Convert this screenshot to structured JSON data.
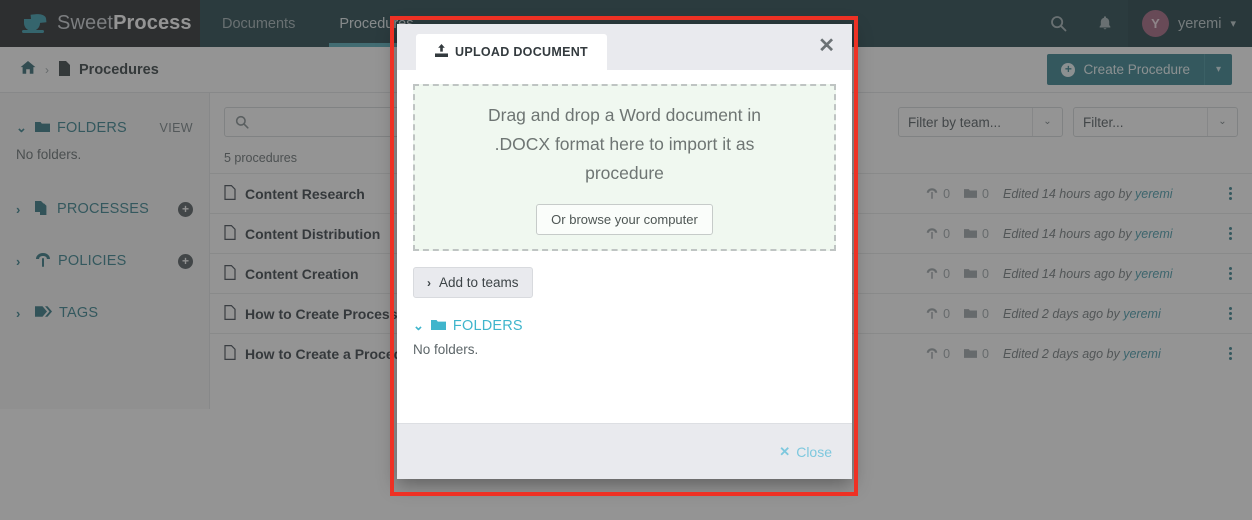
{
  "topnav": {
    "brand_light": "Sweet",
    "brand_bold": "Process",
    "items": [
      {
        "label": "Documents",
        "active": false
      },
      {
        "label": "Procedures",
        "active": true
      }
    ],
    "search_icon": "search-icon",
    "bell_icon": "bell-icon",
    "user": {
      "initial": "Y",
      "name": "yeremi",
      "caret": "⌄"
    }
  },
  "breadcrumb": {
    "home_icon": "home-icon",
    "separator": "›",
    "doc_icon": "document-icon",
    "label": "Procedures"
  },
  "create_button": {
    "plus": "+",
    "label": "Create Procedure",
    "split_caret": "▾"
  },
  "sidebar": {
    "folders": {
      "caret": "⌄",
      "icon": "folder-icon",
      "label": "FOLDERS",
      "view_label": "VIEW",
      "empty": "No folders."
    },
    "items": [
      {
        "caret": "›",
        "icon": "processes-icon",
        "label": "PROCESSES",
        "plus": "+"
      },
      {
        "caret": "›",
        "icon": "policies-icon",
        "label": "POLICIES",
        "plus": "+"
      },
      {
        "caret": "›",
        "icon": "tags-icon",
        "label": "TAGS",
        "plus": ""
      }
    ]
  },
  "toolbar": {
    "search_placeholder": "",
    "search_icon": "search-icon",
    "filter_team": "Filter by team...",
    "filter": "Filter...",
    "caret": "⌄"
  },
  "list": {
    "count_label": "5 procedures",
    "rows": [
      {
        "icon": "document-icon",
        "title": "Content Research",
        "signoff": "0",
        "folders": "0",
        "edited_prefix": "Edited 14 hours ago by ",
        "author": "yeremi",
        "menu": "kebab-menu-icon"
      },
      {
        "icon": "document-icon",
        "title": "Content Distribution",
        "signoff": "0",
        "folders": "0",
        "edited_prefix": "Edited 14 hours ago by ",
        "author": "yeremi",
        "menu": "kebab-menu-icon"
      },
      {
        "icon": "document-icon",
        "title": "Content Creation",
        "signoff": "0",
        "folders": "0",
        "edited_prefix": "Edited 14 hours ago by ",
        "author": "yeremi",
        "menu": "kebab-menu-icon"
      },
      {
        "icon": "document-icon",
        "title": "How to Create Process",
        "signoff": "0",
        "folders": "0",
        "edited_prefix": "Edited 2 days ago by ",
        "author": "yeremi",
        "menu": "kebab-menu-icon"
      },
      {
        "icon": "document-icon",
        "title": "How to Create a Procedure",
        "signoff": "0",
        "folders": "0",
        "edited_prefix": "Edited 2 days ago by ",
        "author": "yeremi",
        "menu": "kebab-menu-icon"
      }
    ]
  },
  "modal": {
    "tab_icon": "upload-icon",
    "tab_label": "UPLOAD DOCUMENT",
    "close_x": "✕",
    "dropzone": {
      "text": "Drag and drop a Word document in .DOCX format here to import it as procedure",
      "browse_label": "Or browse your computer"
    },
    "add_teams": {
      "caret": "›",
      "label": "Add to teams"
    },
    "folders": {
      "caret": "⌄",
      "icon": "folder-icon",
      "label": "FOLDERS",
      "empty": "No folders."
    },
    "footer": {
      "close_icon": "✕",
      "close_label": "Close"
    }
  },
  "highlight": {
    "color": "#ee3124"
  }
}
